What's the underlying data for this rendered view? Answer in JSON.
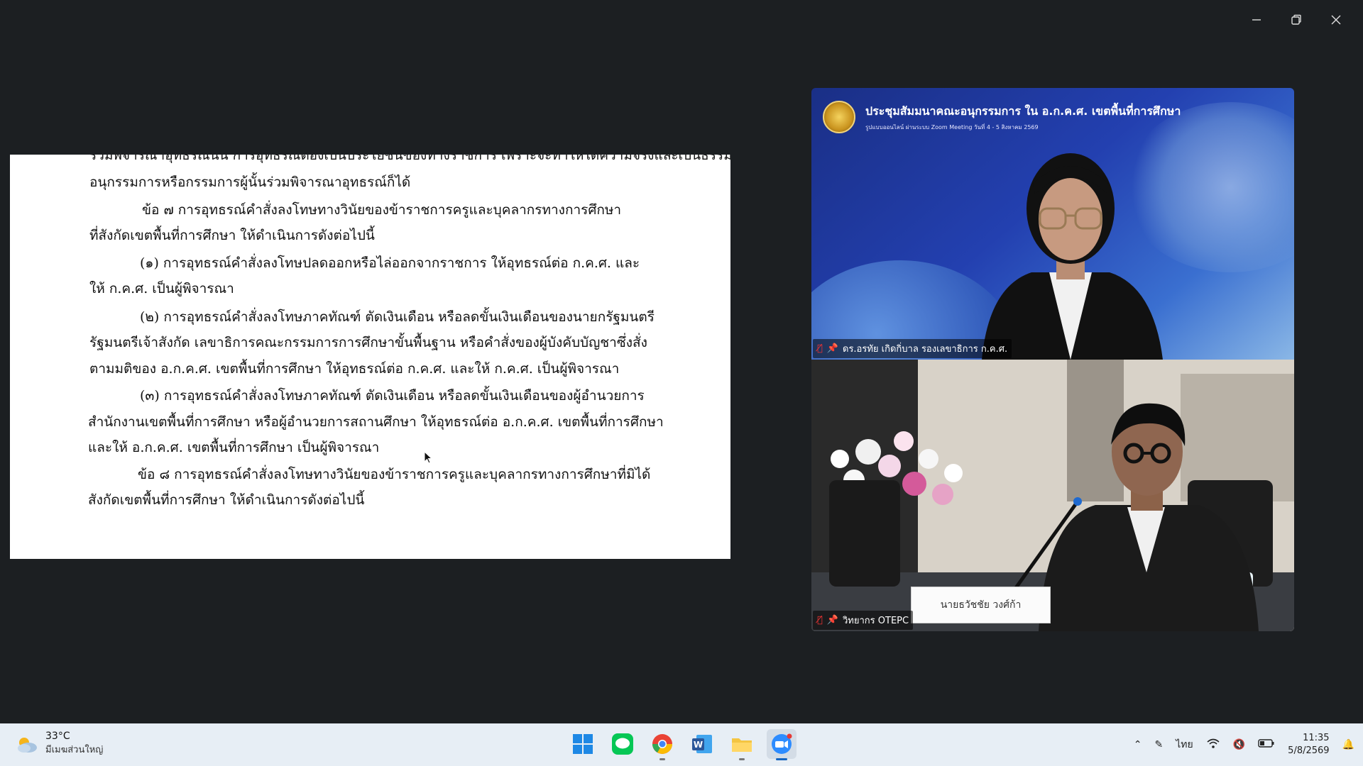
{
  "window": {
    "minimize_label": "—",
    "restore_label": "❐",
    "close_label": "✕"
  },
  "document": {
    "lines": [
      "ร่วมพิจารณาอุทธรณ์นั้น การอุทธรณ์ต้องเป็นประโยชน์ของทางราชการ เพราะจะทำให้ได้ความจริงและเป็นธรรม จะให้",
      "อนุกรรมการหรือกรรมการผู้นั้นร่วมพิจารณาอุทธรณ์ก็ได้",
      "ข้อ ๗  การอุทธรณ์คำสั่งลงโทษทางวินัยของข้าราชการครูและบุคลากรทางการศึกษา",
      "ที่สังกัดเขตพื้นที่การศึกษา ให้ดำเนินการดังต่อไปนี้",
      "(๑) การอุทธรณ์คำสั่งลงโทษปลดออกหรือไล่ออกจากราชการ  ให้อุทธรณ์ต่อ ก.ค.ศ. และ",
      "ให้ ก.ค.ศ. เป็นผู้พิจารณา",
      "(๒) การอุทธรณ์คำสั่งลงโทษภาคทัณฑ์ ตัดเงินเดือน  หรือลดขั้นเงินเดือนของนายกรัฐมนตรี",
      "รัฐมนตรีเจ้าสังกัด เลขาธิการคณะกรรมการการศึกษาขั้นพื้นฐาน  หรือคำสั่งของผู้บังคับบัญชาซึ่งสั่ง",
      "ตามมติของ อ.ก.ค.ศ. เขตพื้นที่การศึกษา  ให้อุทธรณ์ต่อ ก.ค.ศ. และให้ ก.ค.ศ. เป็นผู้พิจารณา",
      "(๓) การอุทธรณ์คำสั่งลงโทษภาคทัณฑ์ ตัดเงินเดือน  หรือลดขั้นเงินเดือนของผู้อำนวยการ",
      "สำนักงานเขตพื้นที่การศึกษา หรือผู้อำนวยการสถานศึกษา ให้อุทธรณ์ต่อ อ.ก.ค.ศ. เขตพื้นที่การศึกษา",
      "และให้ อ.ก.ค.ศ. เขตพื้นที่การศึกษา เป็นผู้พิจารณา",
      "ข้อ ๘  การอุทธรณ์คำสั่งลงโทษทางวินัยของข้าราชการครูและบุคลากรทางการศึกษาที่มิได้",
      "สังกัดเขตพื้นที่การศึกษา ให้ดำเนินการดังต่อไปนี้"
    ]
  },
  "video": {
    "banner_title": "ประชุมสัมมนาคณะอนุกรรมการ ใน อ.ก.ค.ศ. เขตพื้นที่การศึกษา",
    "banner_subtitle": "รูปแบบออนไลน์ ผ่านระบบ Zoom Meeting  วันที่ 4 - 5 สิงหาคม 2569",
    "tile1_name": "ดร.อรทัย เกิดกิ่บาล รองเลขาธิการ ก.ค.ศ.",
    "tile2_name": "วิทยากร OTEPC",
    "tile2_placard": "นายธวัชชัย  วงศ์ก้า"
  },
  "taskbar": {
    "temperature": "33°C",
    "weather_desc": "มีเมฆส่วนใหญ่",
    "language": "ไทย",
    "time": "11:35",
    "date": "5/8/2569",
    "apps": [
      "start-button",
      "line-app",
      "chrome-app",
      "word-app",
      "file-explorer-app",
      "zoom-app"
    ],
    "colors": {
      "zoom": "#2d8cff",
      "line": "#06c755",
      "word": "#2b579a",
      "explorer": "#f4c542",
      "start": "#0078d4"
    }
  }
}
